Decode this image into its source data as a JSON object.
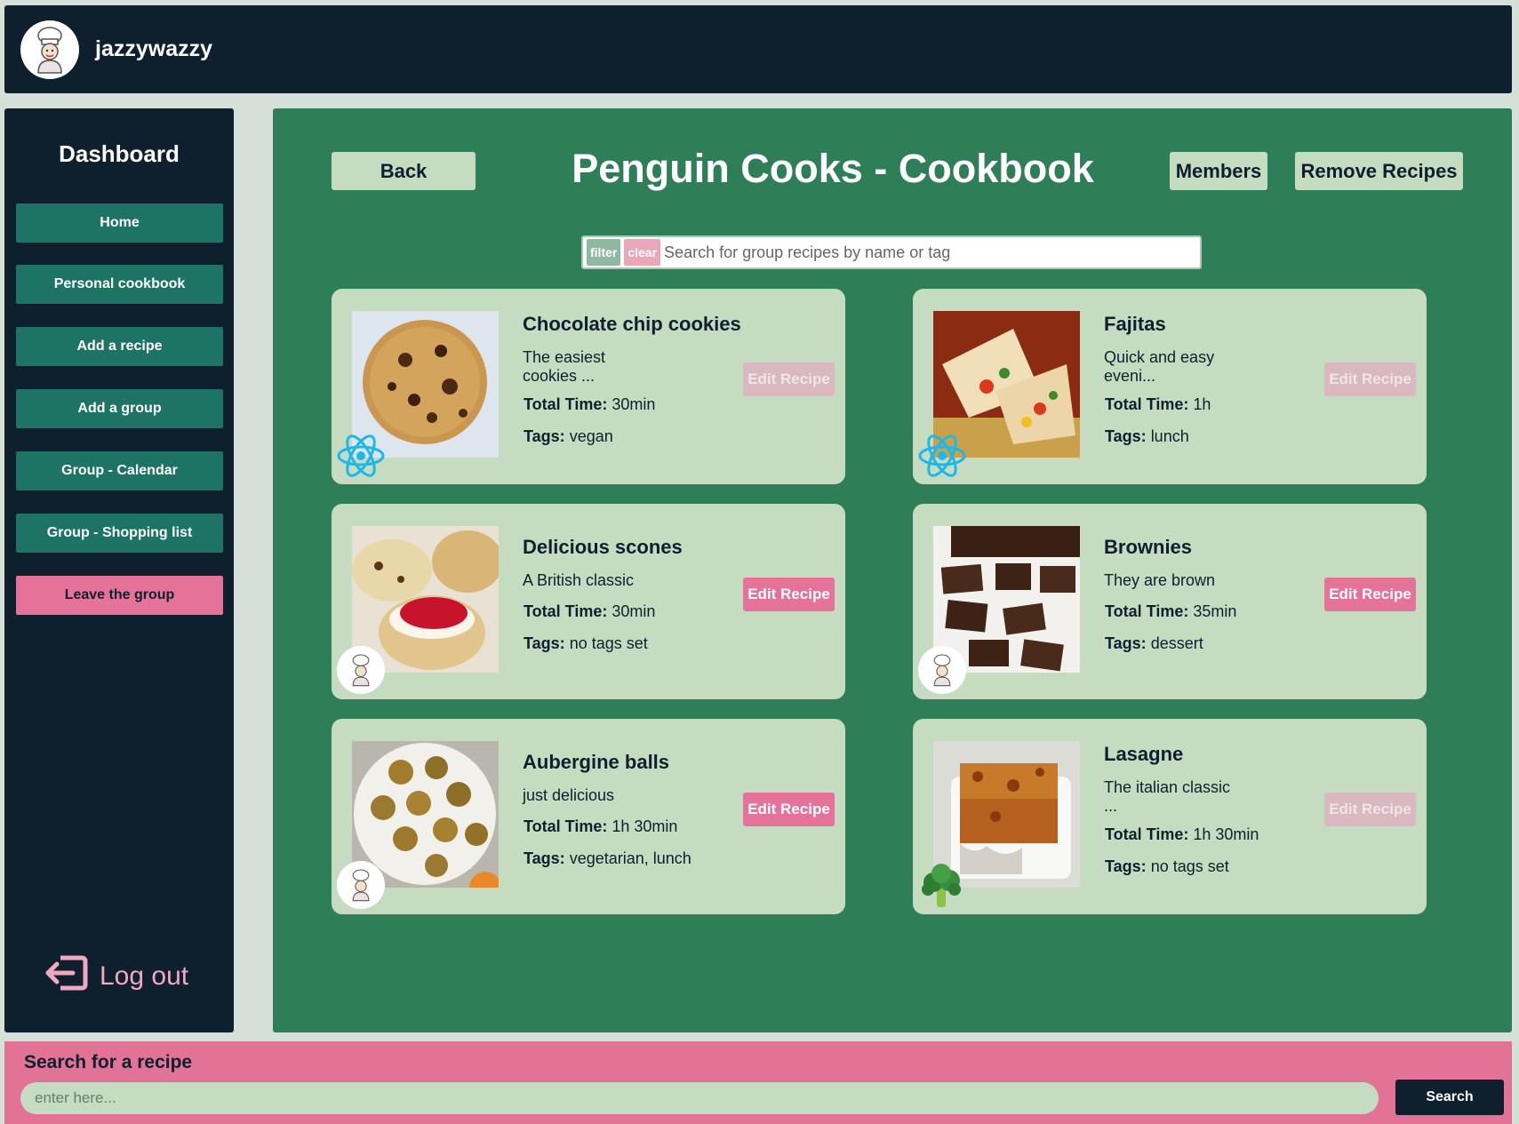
{
  "header": {
    "username": "jazzywazzy",
    "avatar_icon": "chef-avatar-icon"
  },
  "sidebar": {
    "title": "Dashboard",
    "items": [
      {
        "label": "Home"
      },
      {
        "label": "Personal cookbook"
      },
      {
        "label": "Add a recipe"
      },
      {
        "label": "Add a group"
      },
      {
        "label": "Group - Calendar"
      },
      {
        "label": "Group - Shopping list"
      },
      {
        "label": "Leave the group"
      }
    ],
    "logout_label": "Log out"
  },
  "main": {
    "back_label": "Back",
    "title": "Penguin Cooks - Cookbook",
    "members_label": "Members",
    "remove_label": "Remove Recipes",
    "search": {
      "filter_label": "filter",
      "clear_label": "clear",
      "placeholder": "Search for group recipes by name or tag"
    },
    "total_time_label": "Total Time:",
    "tags_label": "Tags:",
    "edit_label": "Edit Recipe",
    "recipes": [
      {
        "name": "Chocolate chip cookies",
        "description": "The easiest cookies ...",
        "total_time": "30min",
        "tags": "vegan",
        "editable": false,
        "badge": "react-icon"
      },
      {
        "name": "Fajitas",
        "description": "Quick and easy eveni...",
        "total_time": "1h",
        "tags": "lunch",
        "editable": false,
        "badge": "react-icon"
      },
      {
        "name": "Delicious scones",
        "description": "A British classic",
        "total_time": "30min",
        "tags": "no tags set",
        "editable": true,
        "badge": "chef-avatar-icon"
      },
      {
        "name": "Brownies",
        "description": "They are brown",
        "total_time": "35min",
        "tags": "dessert",
        "editable": true,
        "badge": "chef-avatar-icon"
      },
      {
        "name": "Aubergine balls",
        "description": "just delicious",
        "total_time": "1h 30min",
        "tags": "vegetarian, lunch",
        "editable": true,
        "badge": "chef-avatar-icon"
      },
      {
        "name": "Lasagne",
        "description": "The italian classic ...",
        "total_time": "1h 30min",
        "tags": "no tags set",
        "editable": false,
        "badge": "broccoli-icon"
      }
    ]
  },
  "footer": {
    "title": "Search for a recipe",
    "placeholder": "enter here...",
    "button_label": "Search"
  },
  "colors": {
    "dark": "#0e1f2e",
    "green_panel": "#2e7e58",
    "card": "#c5dcc0",
    "nav_teal": "#1e7464",
    "pink": "#e57399"
  }
}
